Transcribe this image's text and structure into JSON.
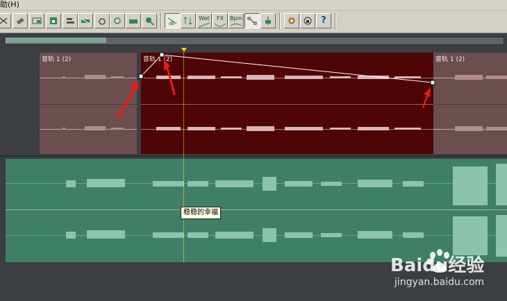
{
  "menubar": {
    "partial_item": "助(H)"
  },
  "toolbar": {
    "buttons": [
      {
        "name": "tool-icon-1"
      },
      {
        "name": "tool-icon-2"
      },
      {
        "name": "tool-icon-3"
      },
      {
        "name": "tool-icon-4"
      },
      {
        "name": "tool-icon-5"
      },
      {
        "name": "tool-icon-6"
      },
      {
        "name": "tool-icon-7"
      },
      {
        "name": "tool-icon-8"
      },
      {
        "name": "tool-icon-9"
      },
      {
        "name": "tool-icon-10"
      },
      {
        "name": "db-envelope-icon",
        "label": "dB"
      },
      {
        "name": "pan-envelope-icon"
      },
      {
        "name": "wet-envelope-icon",
        "label": "Wet"
      },
      {
        "name": "fx-envelope-icon",
        "label": "FX"
      },
      {
        "name": "bpm-envelope-icon",
        "label": "Bpm"
      },
      {
        "name": "edit-envelope-icon"
      },
      {
        "name": "snap-icon"
      },
      {
        "name": "settings-icon"
      },
      {
        "name": "lock-icon"
      },
      {
        "name": "help-icon",
        "label": "?"
      }
    ]
  },
  "tracks": {
    "clip_label": "音轨 1 (2)",
    "tooltip": "稳稳的幸福"
  },
  "colors": {
    "selected_clip": "#4e0505",
    "unselected_clip": "#6b4f50",
    "green_track": "#3f7f66",
    "background": "#3b3e43",
    "cursor": "#f1e35a",
    "annotation_arrow": "#e51c17"
  },
  "watermark": {
    "brand": "Baidu经验",
    "url": "jingyan.baidu.com"
  }
}
